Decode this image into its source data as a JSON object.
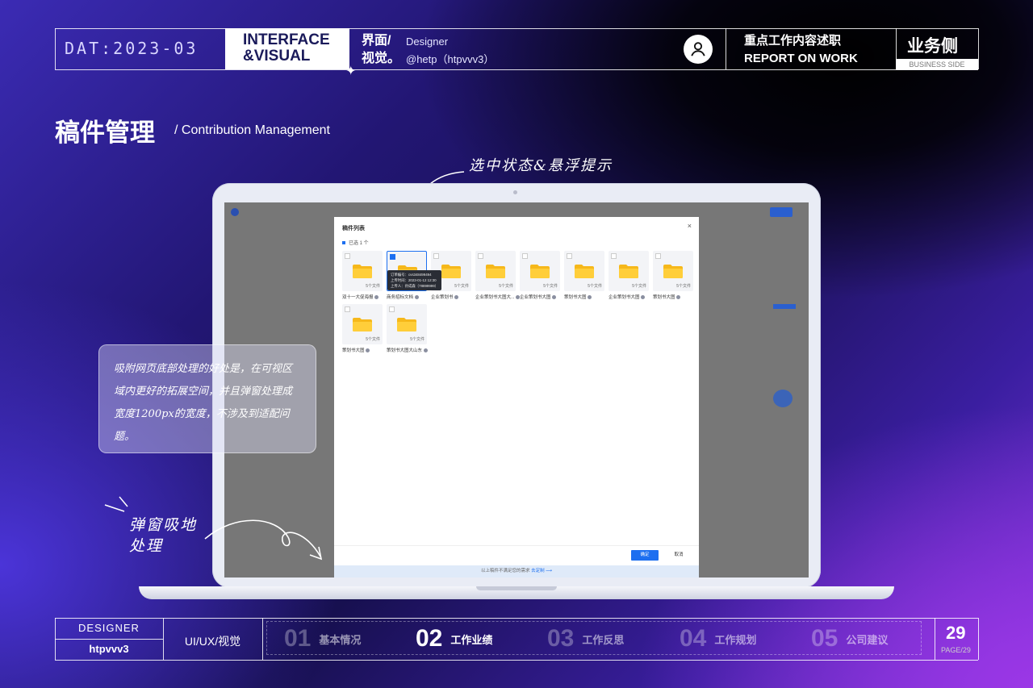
{
  "header": {
    "date": "DAT:2023-03",
    "interface_line1": "INTERFACE",
    "interface_line2": "&VISUAL",
    "cn_line1": "界面/",
    "cn_line2": "视觉。",
    "designer_label": "Designer",
    "designer_handle": "@hetp（htpvvv3）",
    "report_cn": "重点工作内容述职",
    "report_en": "REPORT ON WORK",
    "side_cn": "业务侧",
    "side_en": "BUSINESS SIDE"
  },
  "page": {
    "title": "稿件管理",
    "subtitle": "/ Contribution Management"
  },
  "annotations": {
    "selected_hover": "选中状态&悬浮提示",
    "note": "吸附网页底部处理的好处是，在可视区域内更好的拓展空间，并且弹窗处理成宽度1200px的宽度，不涉及到适配问题。",
    "bottom_line1": "弹窗吸地",
    "bottom_line2": "处理"
  },
  "modal": {
    "title": "稿件列表",
    "close": "×",
    "selected_count": "已选 1 个",
    "files": [
      {
        "name": "双十一大促海报",
        "count": "5个文件",
        "selected": false
      },
      {
        "name": "商务招标文档",
        "count": "5个文件",
        "selected": true
      },
      {
        "name": "企业策划书",
        "count": "5个文件",
        "selected": false
      },
      {
        "name": "企业策划书大图大...",
        "count": "5个文件",
        "selected": false
      },
      {
        "name": "企业策划书大图",
        "count": "5个文件",
        "selected": false
      },
      {
        "name": "策划书大图",
        "count": "5个文件",
        "selected": false
      },
      {
        "name": "企业策划书大图",
        "count": "5个文件",
        "selected": false
      },
      {
        "name": "策划书大图",
        "count": "5个文件",
        "selected": false
      },
      {
        "name": "策划书大图",
        "count": "5个文件",
        "selected": false
      },
      {
        "name": "策划书大图大山东",
        "count": "5个文件",
        "selected": false
      }
    ],
    "tooltip": {
      "line1": "订单编号：cvs348499494",
      "line2": "上传时间：2023-01-12 12:30",
      "line3": "上传人：孙成森（78899999）"
    },
    "ok": "确定",
    "cancel": "取消",
    "bar_text": "以上稿件不满足您的需求",
    "bar_link": "去定制 ⟶"
  },
  "footer": {
    "designer_label": "DESIGNER",
    "designer_name": "htpvvv3",
    "discipline": "UI/UX/视觉",
    "nav": [
      {
        "num": "01",
        "label": "基本情况",
        "active": false
      },
      {
        "num": "02",
        "label": "工作业绩",
        "active": true
      },
      {
        "num": "03",
        "label": "工作反思",
        "active": false
      },
      {
        "num": "04",
        "label": "工作规划",
        "active": false
      },
      {
        "num": "05",
        "label": "公司建议",
        "active": false
      }
    ],
    "page_num": "29",
    "page_total": "PAGE/29"
  },
  "colors": {
    "accent": "#1d6ff0",
    "folder": "#f6b81b"
  }
}
